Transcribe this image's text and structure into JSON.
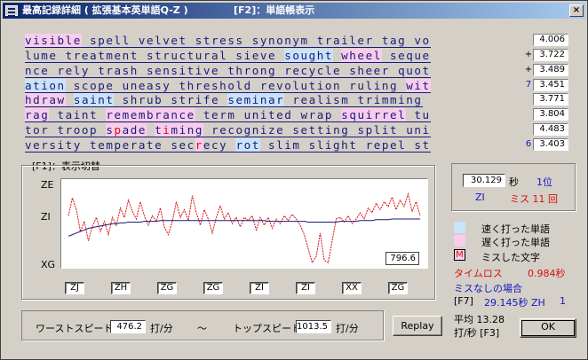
{
  "window": {
    "title": "最高記録詳細 ( 拡張基本英単語Q-Z )",
    "title_hint": "[F2]：単語帳表示",
    "close_label": "×"
  },
  "colors": {
    "fast": "#c9e4f8",
    "slow": "#f8cdec",
    "miss": "#d81010",
    "text": "#1a1a7a"
  },
  "lines": [
    {
      "segments": [
        [
          "visible",
          "p"
        ],
        [
          " spell velvet stress synonym trailer tag vo",
          ""
        ]
      ],
      "score": "4.006",
      "mark": ""
    },
    {
      "segments": [
        [
          "lume treatment structural sieve ",
          ""
        ],
        [
          "sought",
          "b"
        ],
        [
          " ",
          ""
        ],
        [
          "wheel",
          "p"
        ],
        [
          " seque",
          ""
        ]
      ],
      "score": "3.722",
      "mark": "+"
    },
    {
      "segments": [
        [
          "nce rely trash sensitive throng recycle sheer quot",
          ""
        ]
      ],
      "score": "3.489",
      "mark": "+"
    },
    {
      "segments": [
        [
          "ation",
          "b"
        ],
        [
          " scope uneasy threshold revolution ruling ",
          ""
        ],
        [
          "wit",
          "p"
        ]
      ],
      "score": "3.451",
      "mark": "7"
    },
    {
      "segments": [
        [
          "hdraw",
          "p"
        ],
        [
          " ",
          ""
        ],
        [
          "saint",
          "b"
        ],
        [
          " shrub strife ",
          ""
        ],
        [
          "seminar",
          "b"
        ],
        [
          " realism trimming",
          ""
        ]
      ],
      "score": "3.771",
      "mark": ""
    },
    {
      "segments": [
        [
          "rag",
          "p"
        ],
        [
          " taint ",
          ""
        ],
        [
          "remembrance",
          "p"
        ],
        [
          " term united wrap ",
          ""
        ],
        [
          "squirrel",
          "p"
        ],
        [
          " tu",
          ""
        ]
      ],
      "score": "3.804",
      "mark": ""
    },
    {
      "segments": [
        [
          "tor troop ",
          ""
        ],
        [
          "s",
          "p"
        ],
        [
          "p",
          "m"
        ],
        [
          "ade",
          "p"
        ],
        [
          " ",
          ""
        ],
        [
          "t",
          "p"
        ],
        [
          "i",
          "m"
        ],
        [
          "ming",
          "p"
        ],
        [
          " recognize setting split uni",
          ""
        ]
      ],
      "score": "4.483",
      "mark": ""
    },
    {
      "segments": [
        [
          "versity temperate sec",
          ""
        ],
        [
          "r",
          "m"
        ],
        [
          "ecy ",
          ""
        ],
        [
          "rot",
          "b"
        ],
        [
          " slim slight repel st",
          ""
        ]
      ],
      "score": "3.403",
      "mark": "6"
    }
  ],
  "graph": {
    "label": "[F1]：表示切替",
    "y_labels": [
      "ZE",
      "ZI",
      "XG"
    ],
    "readout": "796.6",
    "x_boxes": [
      "ZJ",
      "ZH",
      "ZG",
      "ZG",
      "ZI",
      "ZI",
      "XX",
      "ZG"
    ]
  },
  "chart_data": {
    "type": "line",
    "series": [
      {
        "values": [
          0.62,
          0.85,
          0.7,
          0.42,
          0.55,
          0.3,
          0.48,
          0.6,
          0.42,
          0.55,
          0.38,
          0.6,
          0.5,
          0.72,
          0.6,
          0.82,
          0.68,
          0.58,
          0.8,
          0.62,
          0.5,
          0.62,
          0.55,
          0.72,
          0.48,
          0.38,
          0.55,
          0.8,
          0.6,
          0.7,
          0.56,
          0.88,
          0.66,
          0.5,
          0.7,
          0.58,
          0.4,
          0.6,
          0.75,
          0.58,
          0.66,
          0.52,
          0.6,
          0.48,
          0.6,
          0.56,
          0.62,
          0.44,
          0.6,
          0.5,
          0.6,
          0.46,
          0.58,
          0.52,
          0.62,
          0.56,
          0.64,
          0.58,
          0.5,
          0.38,
          0.2,
          0.02,
          0.1,
          0.4,
          0.05,
          0.02,
          0.3,
          0.58,
          0.6,
          0.54,
          0.62,
          0.52,
          0.58,
          0.66,
          0.58,
          0.72,
          0.66,
          0.78,
          0.7,
          0.8,
          0.74,
          0.86,
          0.7,
          0.82,
          0.74,
          0.9,
          0.68,
          0.8,
          0.62
        ]
      },
      {
        "values": [
          0.36,
          0.38,
          0.4,
          0.42,
          0.44,
          0.46,
          0.47,
          0.48,
          0.49,
          0.5,
          0.51,
          0.52,
          0.52,
          0.53,
          0.53,
          0.54,
          0.54,
          0.54,
          0.54,
          0.55,
          0.55,
          0.55,
          0.55,
          0.56,
          0.56,
          0.56,
          0.56,
          0.56,
          0.56,
          0.56,
          0.56,
          0.56,
          0.56,
          0.56,
          0.56,
          0.56,
          0.56,
          0.56,
          0.56,
          0.56,
          0.56,
          0.56,
          0.56,
          0.56,
          0.56,
          0.56,
          0.56,
          0.56,
          0.56,
          0.56,
          0.55,
          0.55,
          0.55,
          0.55,
          0.55,
          0.55,
          0.55,
          0.55,
          0.55,
          0.55,
          0.54,
          0.54,
          0.54,
          0.54,
          0.54,
          0.54,
          0.54,
          0.54,
          0.55,
          0.55,
          0.55,
          0.55,
          0.55,
          0.56,
          0.56,
          0.56,
          0.56,
          0.57,
          0.57,
          0.57,
          0.57,
          0.58,
          0.58,
          0.58,
          0.58,
          0.58,
          0.58,
          0.58,
          0.58
        ]
      }
    ]
  },
  "stats": {
    "time": "30.129",
    "time_unit": "秒",
    "rank": "1位",
    "rank_word": "ZI",
    "miss": "ミス 11 回"
  },
  "legend": {
    "fast": "速く打った単語",
    "slow": "遅く打った単語",
    "miss_marker": "M",
    "miss": "ミスした文字"
  },
  "loss": {
    "label": "タイムロス",
    "value": "0.984秒",
    "nomiss_label": "ミスなしの場合",
    "f7": "[F7]",
    "nomiss_time": "29.145秒 ZH",
    "nomiss_rank": "1"
  },
  "average": {
    "label": "平均 13.28",
    "unit": "打/秒 [F3]"
  },
  "speed": {
    "worst_label": "ワーストスピード",
    "worst_value": "476.2",
    "worst_unit": "打/分",
    "tilde": "〜",
    "top_label": "トップスピード",
    "top_value": "1013.5",
    "top_unit": "打/分"
  },
  "buttons": {
    "replay": "Replay",
    "ok": "OK"
  }
}
